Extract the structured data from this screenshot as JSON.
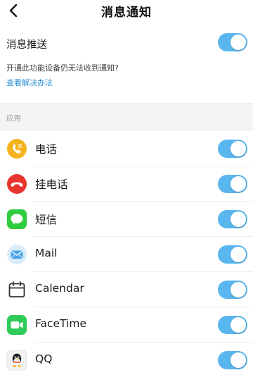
{
  "header": {
    "title": "消息通知"
  },
  "notification": {
    "label": "消息推送",
    "enabled": true,
    "hint": "开通此功能设备仍无法收到通知?",
    "help_link": "查看解决办法"
  },
  "apps_section": {
    "title": "应用",
    "items": [
      {
        "name": "电话",
        "icon": "phone-icon",
        "enabled": true
      },
      {
        "name": "挂电话",
        "icon": "hang-up-icon",
        "enabled": true
      },
      {
        "name": "短信",
        "icon": "message-icon",
        "enabled": true
      },
      {
        "name": "Mail",
        "icon": "mail-icon",
        "enabled": true
      },
      {
        "name": "Calendar",
        "icon": "calendar-icon",
        "enabled": true
      },
      {
        "name": "FaceTime",
        "icon": "facetime-icon",
        "enabled": true
      },
      {
        "name": "QQ",
        "icon": "qq-icon",
        "enabled": true
      }
    ]
  },
  "colors": {
    "toggle_on": "#5ab6ee",
    "link": "#2a8fd6",
    "phone": "#f5b41f",
    "hang_up": "#e8362f",
    "message": "#2fcc3f",
    "mail": "#4aa3e8",
    "facetime": "#2fcc5a"
  }
}
